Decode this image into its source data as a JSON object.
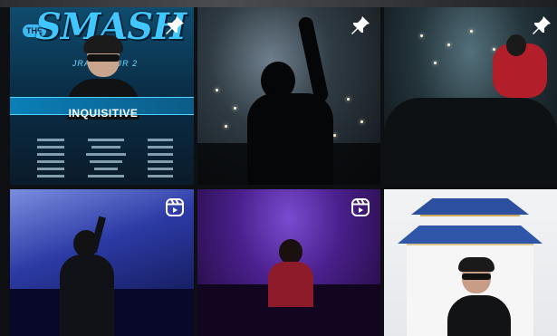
{
  "poster": {
    "the": "THE",
    "title": "SMASH",
    "subtitle": "JRAIZ TOUR 2",
    "artist_name": "INQUISITIVE"
  },
  "tiles": [
    {
      "name": "tile-tour-poster",
      "icon": "pin-icon"
    },
    {
      "name": "tile-concert-stage-silhouette",
      "icon": "pin-icon"
    },
    {
      "name": "tile-concert-crowd",
      "icon": "pin-icon"
    },
    {
      "name": "tile-club-performance",
      "icon": "reels-icon"
    },
    {
      "name": "tile-stage-performance-purple",
      "icon": "reels-icon"
    },
    {
      "name": "tile-memorial-portrait",
      "icon": ""
    }
  ],
  "colors": {
    "poster_accent": "#41c7ff",
    "icon": "#ffffff",
    "memorial_roof": "#2c4fa0"
  }
}
